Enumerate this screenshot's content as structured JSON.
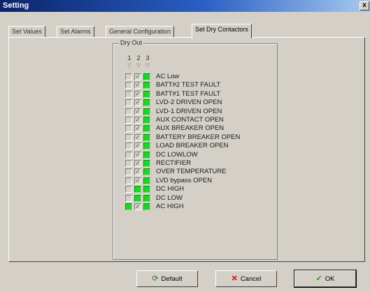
{
  "window": {
    "title": "Setting",
    "close_label": "x"
  },
  "tabs": [
    {
      "label": "Set Values",
      "active": false
    },
    {
      "label": "Set Alarms",
      "active": false
    },
    {
      "label": "General Configuration",
      "active": false
    },
    {
      "label": "Set Dry Contactors",
      "active": true
    }
  ],
  "group": {
    "label": "Dry Out",
    "columns": [
      "1",
      "2",
      "3"
    ],
    "arrow_glyph": "▽"
  },
  "rows": [
    {
      "label": "AC Low",
      "states": [
        "off",
        "mark",
        "on"
      ]
    },
    {
      "label": "BATT#2 TEST FAULT",
      "states": [
        "off",
        "mark",
        "on"
      ]
    },
    {
      "label": "BATT#1 TEST FAULT",
      "states": [
        "off",
        "mark",
        "on"
      ]
    },
    {
      "label": "LVD-2 DRIVEN OPEN",
      "states": [
        "off",
        "mark",
        "on"
      ]
    },
    {
      "label": "LVD-1 DRIVEN OPEN",
      "states": [
        "off",
        "mark",
        "on"
      ]
    },
    {
      "label": "AUX CONTACT OPEN",
      "states": [
        "off",
        "mark",
        "on"
      ]
    },
    {
      "label": "AUX BREAKER OPEN",
      "states": [
        "off",
        "mark",
        "on"
      ]
    },
    {
      "label": "BATTERY BREAKER OPEN",
      "states": [
        "off",
        "mark",
        "on"
      ]
    },
    {
      "label": "LOAD BREAKER OPEN",
      "states": [
        "off",
        "mark",
        "on"
      ]
    },
    {
      "label": "DC LOWLOW",
      "states": [
        "off",
        "mark",
        "on"
      ]
    },
    {
      "label": "RECTIFIER",
      "states": [
        "off",
        "mark",
        "on"
      ]
    },
    {
      "label": "OVER TEMPERATURE",
      "states": [
        "off",
        "mark",
        "on"
      ]
    },
    {
      "label": "LVD bypass OPEN",
      "states": [
        "off",
        "mark",
        "on"
      ]
    },
    {
      "label": "DC HIGH",
      "states": [
        "off",
        "on",
        "on"
      ]
    },
    {
      "label": "DC LOW",
      "states": [
        "off",
        "on",
        "on"
      ]
    },
    {
      "label": "AC HIGH",
      "states": [
        "on",
        "mark",
        "on"
      ]
    }
  ],
  "buttons": {
    "default_label": "Default",
    "cancel_label": "Cancel",
    "ok_label": "OK"
  },
  "icons": {
    "default": "refresh-icon",
    "cancel": "red-x-icon",
    "ok": "green-check-icon"
  },
  "colors": {
    "checked_green": "#22d22a",
    "title_start": "#0a246a",
    "cancel_red": "#d40000",
    "ok_green": "#1a9a1a"
  }
}
